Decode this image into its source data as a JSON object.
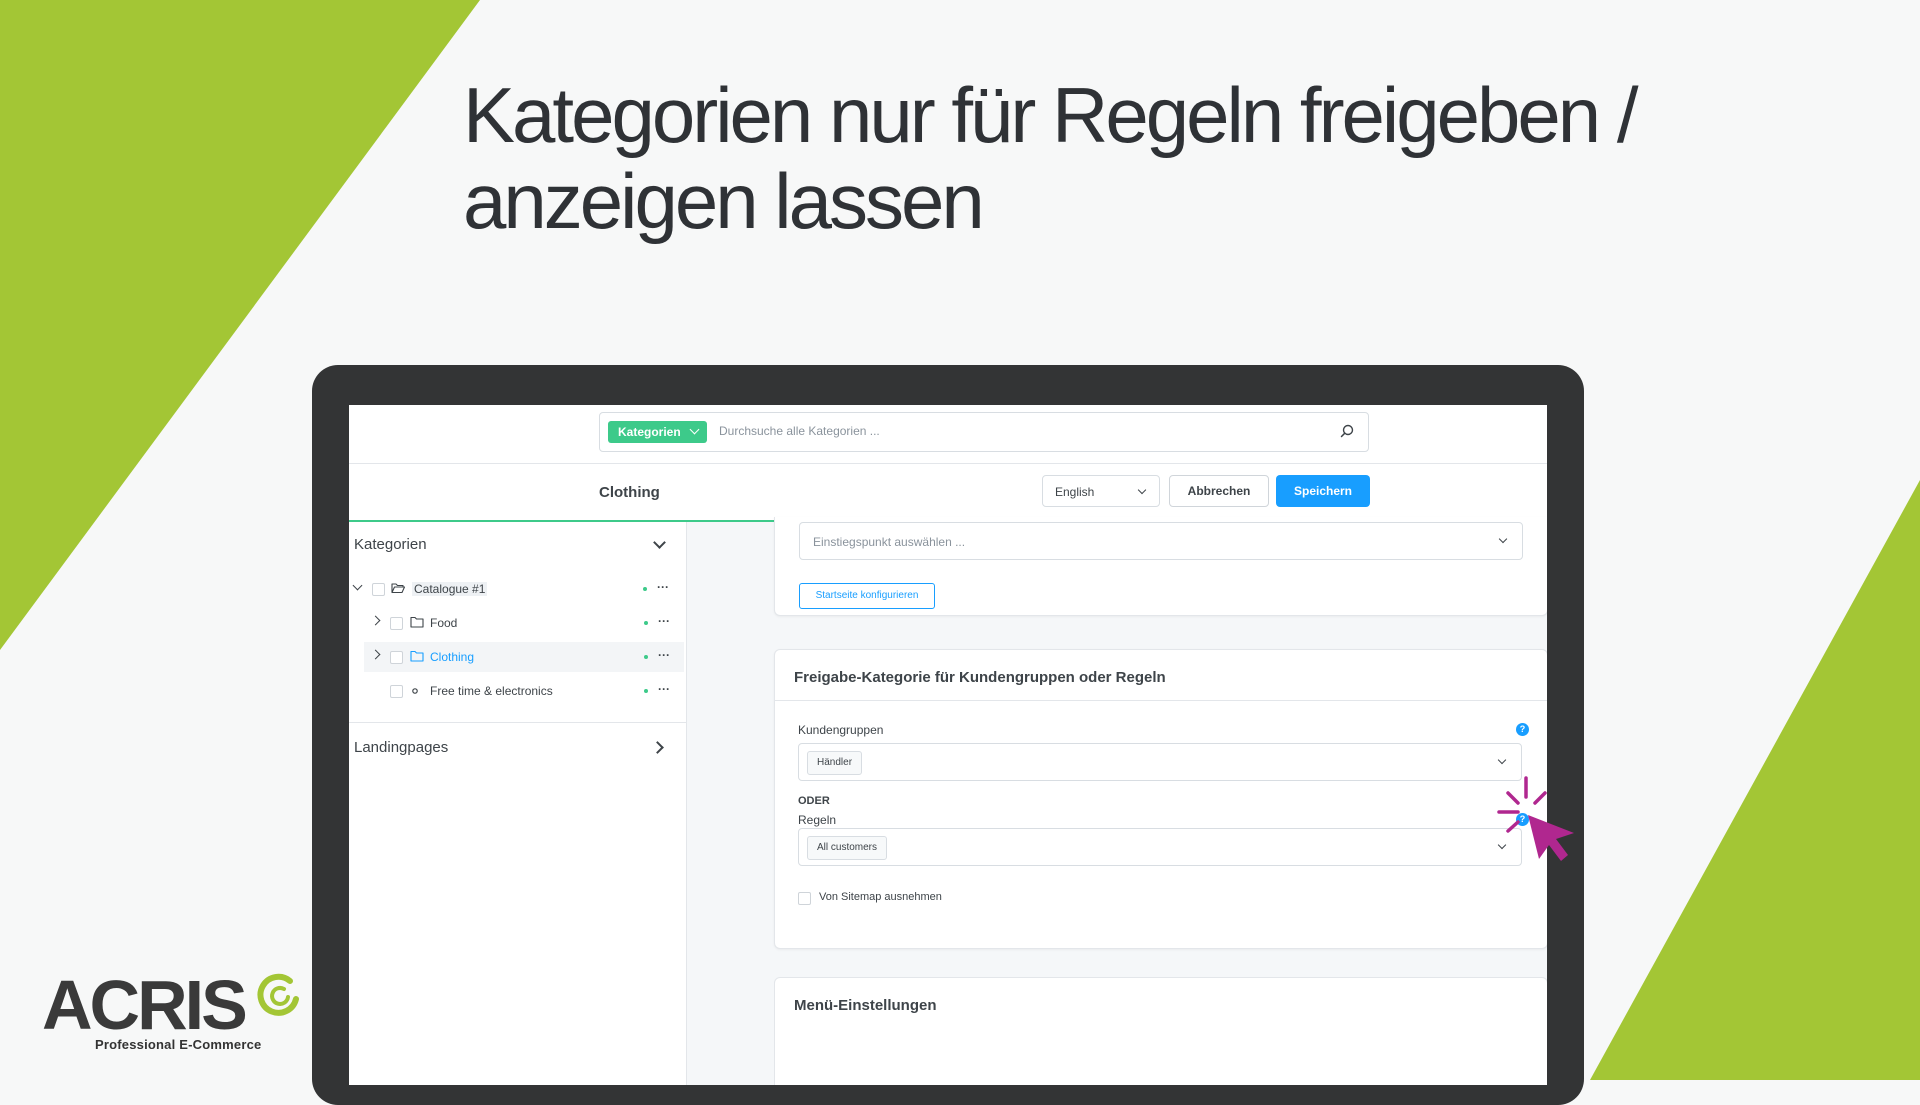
{
  "headline": {
    "line1": "Kategorien nur für Regeln freigeben /",
    "line2": "anzeigen lassen"
  },
  "brand": {
    "name": "ACRIS",
    "tagline": "Professional E-Commerce",
    "color_green": "#a3c635"
  },
  "search": {
    "scope_label": "Kategorien",
    "placeholder": "Durchsuche alle Kategorien ..."
  },
  "actionbar": {
    "breadcrumb": "Clothing",
    "language": "English",
    "cancel_label": "Abbrechen",
    "save_label": "Speichern"
  },
  "sidebar": {
    "title": "Kategorien",
    "tree": [
      {
        "label": "Catalogue #1",
        "level": 0,
        "expanded": true
      },
      {
        "label": "Food",
        "level": 1,
        "expanded": false
      },
      {
        "label": "Clothing",
        "level": 1,
        "expanded": false,
        "active": true
      },
      {
        "label": "Free time & electronics",
        "level": 1
      }
    ],
    "more_label": "···",
    "landing_title": "Landingpages"
  },
  "entry_card": {
    "entry_placeholder": "Einstiegspunkt auswählen ...",
    "configure_label": "Startseite konfigurieren"
  },
  "release_card": {
    "title": "Freigabe-Kategorie für Kundengruppen oder Regeln",
    "customer_groups_label": "Kundengruppen",
    "customer_group_tag": "Händler",
    "or_label": "ODER",
    "rules_label": "Regeln",
    "rule_tag": "All customers",
    "help_label": "?",
    "sitemap_label": "Von Sitemap ausnehmen"
  },
  "menu_card": {
    "title": "Menü-Einstellungen"
  },
  "colors": {
    "primary_blue": "#189eff",
    "accent_green": "#3dca8a",
    "cursor_magenta": "#b0278f"
  }
}
